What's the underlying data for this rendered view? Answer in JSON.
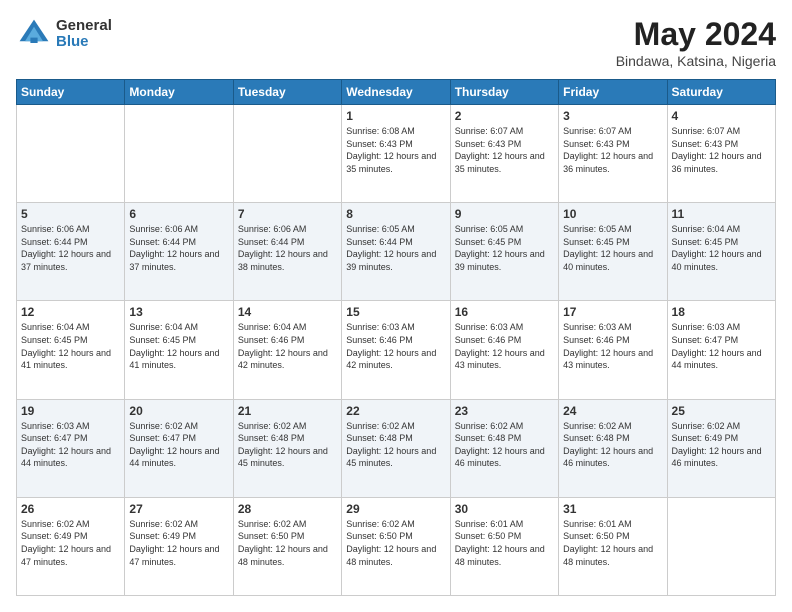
{
  "logo": {
    "general": "General",
    "blue": "Blue"
  },
  "header": {
    "title": "May 2024",
    "subtitle": "Bindawa, Katsina, Nigeria"
  },
  "weekdays": [
    "Sunday",
    "Monday",
    "Tuesday",
    "Wednesday",
    "Thursday",
    "Friday",
    "Saturday"
  ],
  "weeks": [
    [
      {
        "day": "",
        "sunrise": "",
        "sunset": "",
        "daylight": ""
      },
      {
        "day": "",
        "sunrise": "",
        "sunset": "",
        "daylight": ""
      },
      {
        "day": "",
        "sunrise": "",
        "sunset": "",
        "daylight": ""
      },
      {
        "day": "1",
        "sunrise": "Sunrise: 6:08 AM",
        "sunset": "Sunset: 6:43 PM",
        "daylight": "Daylight: 12 hours and 35 minutes."
      },
      {
        "day": "2",
        "sunrise": "Sunrise: 6:07 AM",
        "sunset": "Sunset: 6:43 PM",
        "daylight": "Daylight: 12 hours and 35 minutes."
      },
      {
        "day": "3",
        "sunrise": "Sunrise: 6:07 AM",
        "sunset": "Sunset: 6:43 PM",
        "daylight": "Daylight: 12 hours and 36 minutes."
      },
      {
        "day": "4",
        "sunrise": "Sunrise: 6:07 AM",
        "sunset": "Sunset: 6:43 PM",
        "daylight": "Daylight: 12 hours and 36 minutes."
      }
    ],
    [
      {
        "day": "5",
        "sunrise": "Sunrise: 6:06 AM",
        "sunset": "Sunset: 6:44 PM",
        "daylight": "Daylight: 12 hours and 37 minutes."
      },
      {
        "day": "6",
        "sunrise": "Sunrise: 6:06 AM",
        "sunset": "Sunset: 6:44 PM",
        "daylight": "Daylight: 12 hours and 37 minutes."
      },
      {
        "day": "7",
        "sunrise": "Sunrise: 6:06 AM",
        "sunset": "Sunset: 6:44 PM",
        "daylight": "Daylight: 12 hours and 38 minutes."
      },
      {
        "day": "8",
        "sunrise": "Sunrise: 6:05 AM",
        "sunset": "Sunset: 6:44 PM",
        "daylight": "Daylight: 12 hours and 39 minutes."
      },
      {
        "day": "9",
        "sunrise": "Sunrise: 6:05 AM",
        "sunset": "Sunset: 6:45 PM",
        "daylight": "Daylight: 12 hours and 39 minutes."
      },
      {
        "day": "10",
        "sunrise": "Sunrise: 6:05 AM",
        "sunset": "Sunset: 6:45 PM",
        "daylight": "Daylight: 12 hours and 40 minutes."
      },
      {
        "day": "11",
        "sunrise": "Sunrise: 6:04 AM",
        "sunset": "Sunset: 6:45 PM",
        "daylight": "Daylight: 12 hours and 40 minutes."
      }
    ],
    [
      {
        "day": "12",
        "sunrise": "Sunrise: 6:04 AM",
        "sunset": "Sunset: 6:45 PM",
        "daylight": "Daylight: 12 hours and 41 minutes."
      },
      {
        "day": "13",
        "sunrise": "Sunrise: 6:04 AM",
        "sunset": "Sunset: 6:45 PM",
        "daylight": "Daylight: 12 hours and 41 minutes."
      },
      {
        "day": "14",
        "sunrise": "Sunrise: 6:04 AM",
        "sunset": "Sunset: 6:46 PM",
        "daylight": "Daylight: 12 hours and 42 minutes."
      },
      {
        "day": "15",
        "sunrise": "Sunrise: 6:03 AM",
        "sunset": "Sunset: 6:46 PM",
        "daylight": "Daylight: 12 hours and 42 minutes."
      },
      {
        "day": "16",
        "sunrise": "Sunrise: 6:03 AM",
        "sunset": "Sunset: 6:46 PM",
        "daylight": "Daylight: 12 hours and 43 minutes."
      },
      {
        "day": "17",
        "sunrise": "Sunrise: 6:03 AM",
        "sunset": "Sunset: 6:46 PM",
        "daylight": "Daylight: 12 hours and 43 minutes."
      },
      {
        "day": "18",
        "sunrise": "Sunrise: 6:03 AM",
        "sunset": "Sunset: 6:47 PM",
        "daylight": "Daylight: 12 hours and 44 minutes."
      }
    ],
    [
      {
        "day": "19",
        "sunrise": "Sunrise: 6:03 AM",
        "sunset": "Sunset: 6:47 PM",
        "daylight": "Daylight: 12 hours and 44 minutes."
      },
      {
        "day": "20",
        "sunrise": "Sunrise: 6:02 AM",
        "sunset": "Sunset: 6:47 PM",
        "daylight": "Daylight: 12 hours and 44 minutes."
      },
      {
        "day": "21",
        "sunrise": "Sunrise: 6:02 AM",
        "sunset": "Sunset: 6:48 PM",
        "daylight": "Daylight: 12 hours and 45 minutes."
      },
      {
        "day": "22",
        "sunrise": "Sunrise: 6:02 AM",
        "sunset": "Sunset: 6:48 PM",
        "daylight": "Daylight: 12 hours and 45 minutes."
      },
      {
        "day": "23",
        "sunrise": "Sunrise: 6:02 AM",
        "sunset": "Sunset: 6:48 PM",
        "daylight": "Daylight: 12 hours and 46 minutes."
      },
      {
        "day": "24",
        "sunrise": "Sunrise: 6:02 AM",
        "sunset": "Sunset: 6:48 PM",
        "daylight": "Daylight: 12 hours and 46 minutes."
      },
      {
        "day": "25",
        "sunrise": "Sunrise: 6:02 AM",
        "sunset": "Sunset: 6:49 PM",
        "daylight": "Daylight: 12 hours and 46 minutes."
      }
    ],
    [
      {
        "day": "26",
        "sunrise": "Sunrise: 6:02 AM",
        "sunset": "Sunset: 6:49 PM",
        "daylight": "Daylight: 12 hours and 47 minutes."
      },
      {
        "day": "27",
        "sunrise": "Sunrise: 6:02 AM",
        "sunset": "Sunset: 6:49 PM",
        "daylight": "Daylight: 12 hours and 47 minutes."
      },
      {
        "day": "28",
        "sunrise": "Sunrise: 6:02 AM",
        "sunset": "Sunset: 6:50 PM",
        "daylight": "Daylight: 12 hours and 48 minutes."
      },
      {
        "day": "29",
        "sunrise": "Sunrise: 6:02 AM",
        "sunset": "Sunset: 6:50 PM",
        "daylight": "Daylight: 12 hours and 48 minutes."
      },
      {
        "day": "30",
        "sunrise": "Sunrise: 6:01 AM",
        "sunset": "Sunset: 6:50 PM",
        "daylight": "Daylight: 12 hours and 48 minutes."
      },
      {
        "day": "31",
        "sunrise": "Sunrise: 6:01 AM",
        "sunset": "Sunset: 6:50 PM",
        "daylight": "Daylight: 12 hours and 48 minutes."
      },
      {
        "day": "",
        "sunrise": "",
        "sunset": "",
        "daylight": ""
      }
    ]
  ]
}
